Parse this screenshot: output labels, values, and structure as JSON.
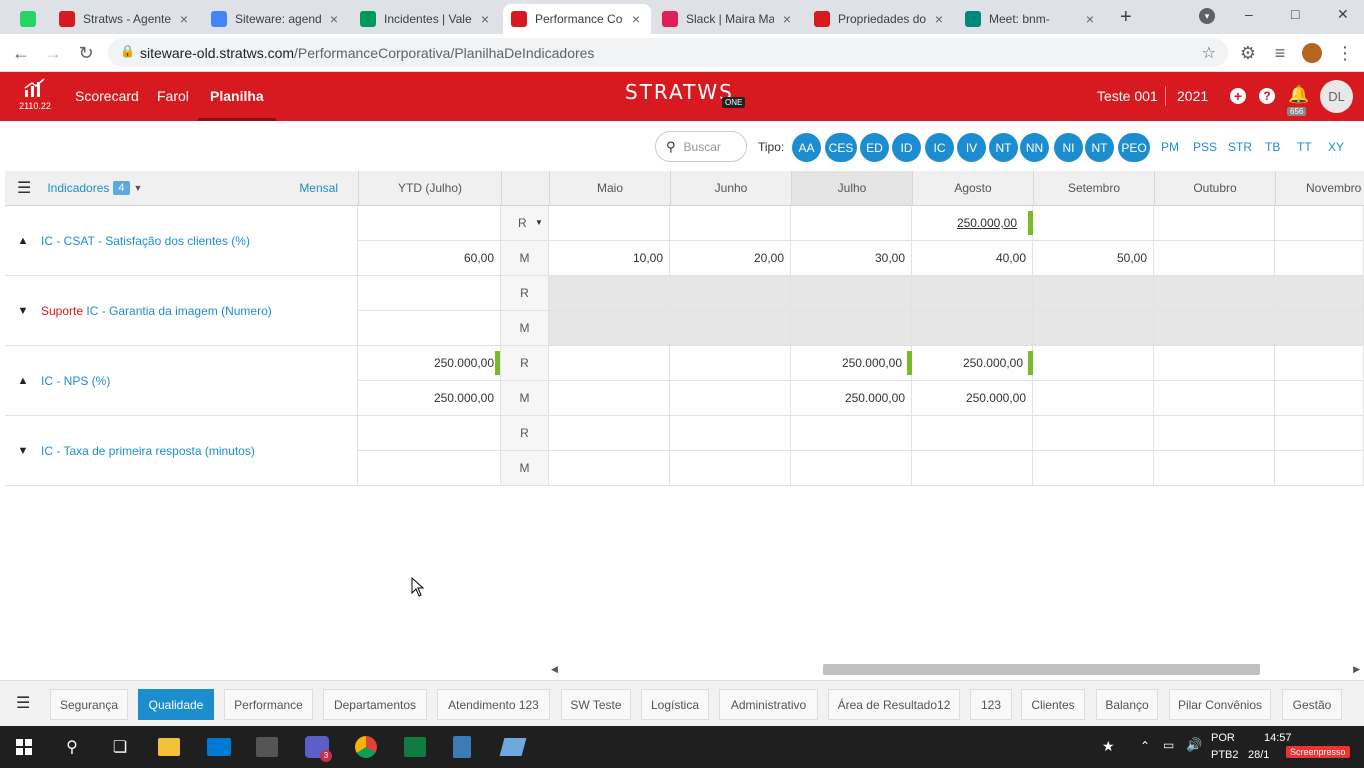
{
  "browser": {
    "tabs": [
      {
        "title": "",
        "icon": "whatsapp-icon",
        "color": "#25d366"
      },
      {
        "title": "Stratws - Agente",
        "icon": "stratws-icon",
        "color": "#d71920"
      },
      {
        "title": "Siteware: agenda",
        "icon": "calendar-icon",
        "color": "#4285f4"
      },
      {
        "title": "Incidentes | Vale",
        "icon": "vale-icon",
        "color": "#00995d"
      },
      {
        "title": "Performance Co",
        "icon": "performance-icon",
        "color": "#d71920"
      },
      {
        "title": "Slack | Maira Ma",
        "icon": "slack-icon",
        "color": "#e01e5a"
      },
      {
        "title": "Propriedades do",
        "icon": "properties-icon",
        "color": "#d71920"
      },
      {
        "title": "Meet: bnm-",
        "icon": "meet-icon",
        "color": "#00897b"
      }
    ],
    "url_host": "siteware-old.stratws.com",
    "url_path": "/PerformanceCorporativa/PlanilhaDeIndicadores"
  },
  "app": {
    "version": "2110.22",
    "menu": [
      "Scorecard",
      "Farol",
      "Planilha"
    ],
    "logo_text": "STRATWS",
    "logo_sub": "ONE",
    "context": "Teste 001",
    "year": "2021",
    "notifications": "656",
    "avatar": "DL",
    "brand_color": "#d71920"
  },
  "filter": {
    "search_placeholder": "Buscar",
    "tipo_label": "Tipo:",
    "pills": [
      "AA",
      "CES",
      "ED",
      "ID",
      "IC",
      "IV",
      "NT",
      "NN",
      "NI",
      "NT",
      "PEO"
    ],
    "plain": [
      "PM",
      "PSS",
      "STR",
      "TB",
      "TT",
      "XY"
    ]
  },
  "grid": {
    "indicators_label": "Indicadores",
    "indicators_count": "4",
    "period": "Mensal",
    "ytd": "YTD (Julho)",
    "months": [
      "Maio",
      "Junho",
      "Julho",
      "Agosto",
      "Setembro",
      "Outubro",
      "Novembro"
    ],
    "rows": [
      {
        "prefix": "",
        "name": "IC - CSAT - Satisfação dos clientes (%)",
        "arrow": "up",
        "r_label": "R",
        "m_label": "M",
        "ytd_r": "",
        "ytd_m": "60,00",
        "r": [
          "",
          "",
          "",
          "250.000,00",
          "",
          "",
          ""
        ],
        "m": [
          "10,00",
          "20,00",
          "30,00",
          "40,00",
          "50,00",
          "",
          ""
        ]
      },
      {
        "prefix": "Suporte",
        "name": " IC - Garantia da imagem (Numero)",
        "arrow": "down",
        "r_label": "R",
        "m_label": "M",
        "ytd_r": "",
        "ytd_m": "",
        "r": [
          "",
          "",
          "",
          "",
          "",
          "",
          ""
        ],
        "m": [
          "",
          "",
          "",
          "",
          "",
          "",
          ""
        ]
      },
      {
        "prefix": "",
        "name": "IC - NPS (%)",
        "arrow": "up",
        "r_label": "R",
        "m_label": "M",
        "ytd_r": "250.000,00",
        "ytd_m": "250.000,00",
        "r": [
          "",
          "",
          "250.000,00",
          "250.000,00",
          "",
          "",
          ""
        ],
        "m": [
          "",
          "",
          "250.000,00",
          "250.000,00",
          "",
          "",
          ""
        ]
      },
      {
        "prefix": "",
        "name": "IC - Taxa de primeira resposta (minutos)",
        "arrow": "down",
        "r_label": "R",
        "m_label": "M",
        "ytd_r": "",
        "ytd_m": "",
        "r": [
          "",
          "",
          "",
          "",
          "",
          "",
          ""
        ],
        "m": [
          "",
          "",
          "",
          "",
          "",
          "",
          ""
        ]
      }
    ]
  },
  "bottom_tabs": [
    "Segurança",
    "Qualidade",
    "Performance",
    "Departamentos",
    "Atendimento 123",
    "SW Teste",
    "Logística",
    "Administrativo",
    "Área de Resultado12",
    "123",
    "Clientes",
    "Balanço",
    "Pilar Convênios",
    "Gestão"
  ],
  "active_bottom_tab": "Qualidade",
  "taskbar": {
    "lang": "POR",
    "layout": "PTB2",
    "time": "14:57",
    "date": "28/1",
    "teams_badge": "3",
    "watermark": "Screenpresso"
  }
}
